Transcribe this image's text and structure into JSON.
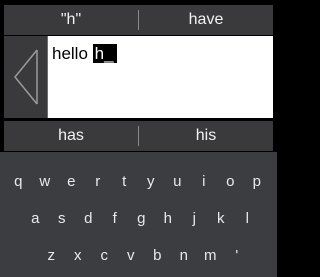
{
  "suggestions_top": [
    "\"h\"",
    "have"
  ],
  "suggestions_bottom": [
    "has",
    "his"
  ],
  "editor": {
    "typed_text": "hello ",
    "current_word": "h_"
  },
  "keyboard": {
    "row1": [
      "q",
      "w",
      "e",
      "r",
      "t",
      "y",
      "u",
      "i",
      "o",
      "p"
    ],
    "row2": [
      "a",
      "s",
      "d",
      "f",
      "g",
      "h",
      "j",
      "k",
      "l"
    ],
    "row3": [
      "z",
      "x",
      "c",
      "v",
      "b",
      "n",
      "m",
      "'"
    ]
  },
  "icons": {
    "back": "left-triangle-icon"
  },
  "colors": {
    "panel": "#3a3a3c",
    "keyboard_bg": "#3b3d40",
    "key_text": "#e9e9e9",
    "editor_bg": "#ffffff"
  }
}
